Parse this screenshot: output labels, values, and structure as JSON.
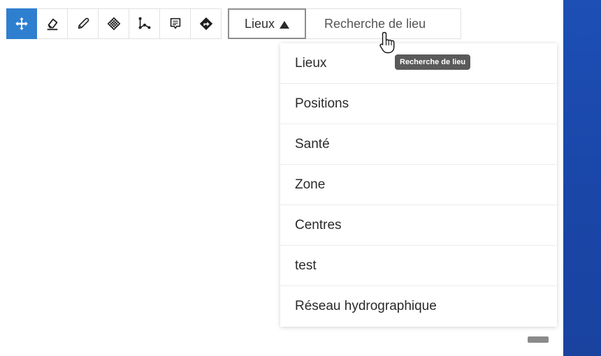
{
  "toolbar": {
    "tools": [
      {
        "icon": "move-pan-icon",
        "active": true
      },
      {
        "icon": "eraser-icon",
        "active": false
      },
      {
        "icon": "pencil-icon",
        "active": false
      },
      {
        "icon": "area-hatch-icon",
        "active": false
      },
      {
        "icon": "measure-line-icon",
        "active": false
      },
      {
        "icon": "comment-icon",
        "active": false
      },
      {
        "icon": "directions-icon",
        "active": false
      }
    ],
    "lieux_button_label": "Lieux",
    "search_placeholder": "Recherche de lieu"
  },
  "dropdown": {
    "items": [
      "Lieux",
      "Positions",
      "Santé",
      "Zone",
      "Centres",
      "test",
      "Réseau hydrographique"
    ]
  },
  "tooltip": {
    "text": "Recherche de lieu"
  },
  "colors": {
    "active_tool": "#2f7fd0",
    "right_panel": "#1d4fb5",
    "tooltip_bg": "#5a5a5a"
  }
}
